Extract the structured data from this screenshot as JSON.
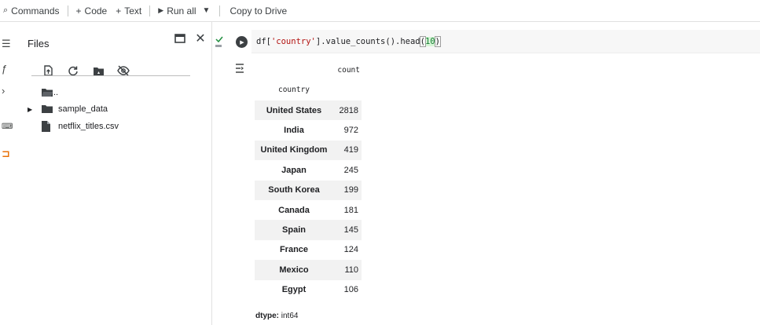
{
  "toolbar": {
    "commands_label": "Commands",
    "code_label": "Code",
    "text_label": "Text",
    "run_all_label": "Run all",
    "copy_to_drive_label": "Copy to Drive"
  },
  "files_panel": {
    "title": "Files",
    "tree": [
      {
        "name": "..",
        "type": "parent-folder"
      },
      {
        "name": "sample_data",
        "type": "folder"
      },
      {
        "name": "netflix_titles.csv",
        "type": "file"
      }
    ]
  },
  "cell": {
    "code_prefix": "df[",
    "code_string": "'country'",
    "code_mid": "].value_counts().head",
    "code_open": "(",
    "code_arg": "10",
    "code_close": ")"
  },
  "output": {
    "column_header": "count",
    "index_header": "country",
    "rows": [
      {
        "country": "United States",
        "count": "2818"
      },
      {
        "country": "India",
        "count": "972"
      },
      {
        "country": "United Kingdom",
        "count": "419"
      },
      {
        "country": "Japan",
        "count": "245"
      },
      {
        "country": "South Korea",
        "count": "199"
      },
      {
        "country": "Canada",
        "count": "181"
      },
      {
        "country": "Spain",
        "count": "145"
      },
      {
        "country": "France",
        "count": "124"
      },
      {
        "country": "Mexico",
        "count": "110"
      },
      {
        "country": "Egypt",
        "count": "106"
      }
    ],
    "dtype_label": "dtype:",
    "dtype_value": " int64"
  },
  "icons": {
    "commands": "search-icon",
    "code": "plus-icon",
    "text": "plus-icon",
    "run_all": "play-icon",
    "menu": "menu-icon",
    "upload": "upload-icon",
    "refresh": "refresh-icon",
    "drive": "drive-folder-icon",
    "hidden": "eye-off-icon"
  },
  "colors": {
    "accent_orange": "#e8710a",
    "string_red": "#b31412",
    "success_green": "#1e8e3e"
  }
}
